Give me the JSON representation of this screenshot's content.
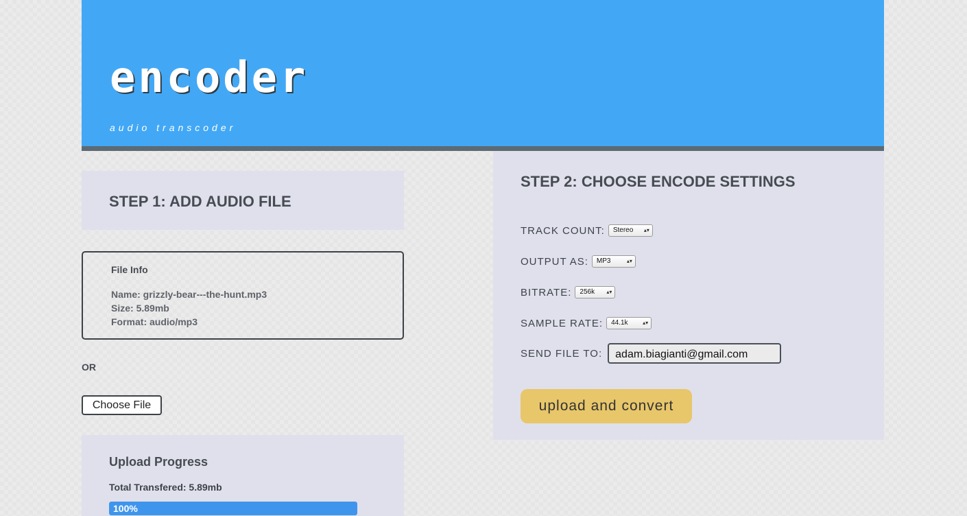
{
  "header": {
    "title": "encoder",
    "tagline": "audio transcoder"
  },
  "step1": {
    "title": "STEP 1: ADD AUDIO FILE",
    "file_info": {
      "heading": "File Info",
      "name_line": "Name: grizzly-bear---the-hunt.mp3",
      "size_line": "Size: 5.89mb",
      "format_line": "Format: audio/mp3"
    },
    "or_label": "OR",
    "choose_file_label": "Choose File"
  },
  "upload_progress": {
    "title": "Upload Progress",
    "total_transferred": "Total Transfered: 5.89mb",
    "percent_label": "100%",
    "percent": 100
  },
  "step2": {
    "title": "STEP 2: CHOOSE ENCODE SETTINGS",
    "track_count": {
      "label": "TRACK COUNT:",
      "value": "Stereo"
    },
    "output_as": {
      "label": "OUTPUT AS:",
      "value": "MP3"
    },
    "bitrate": {
      "label": "BITRATE:",
      "value": "256k"
    },
    "sample_rate": {
      "label": "SAMPLE RATE:",
      "value": "44.1k"
    },
    "send_file_to": {
      "label": "SEND FILE TO:",
      "value": "adam.biagianti@gmail.com"
    },
    "submit_label": "upload and convert"
  },
  "colors": {
    "header_bg": "#42a8f5",
    "panel_bg": "#dfe0eb",
    "button_bg": "#e8c66a",
    "progress_fill": "#3f95ec"
  }
}
